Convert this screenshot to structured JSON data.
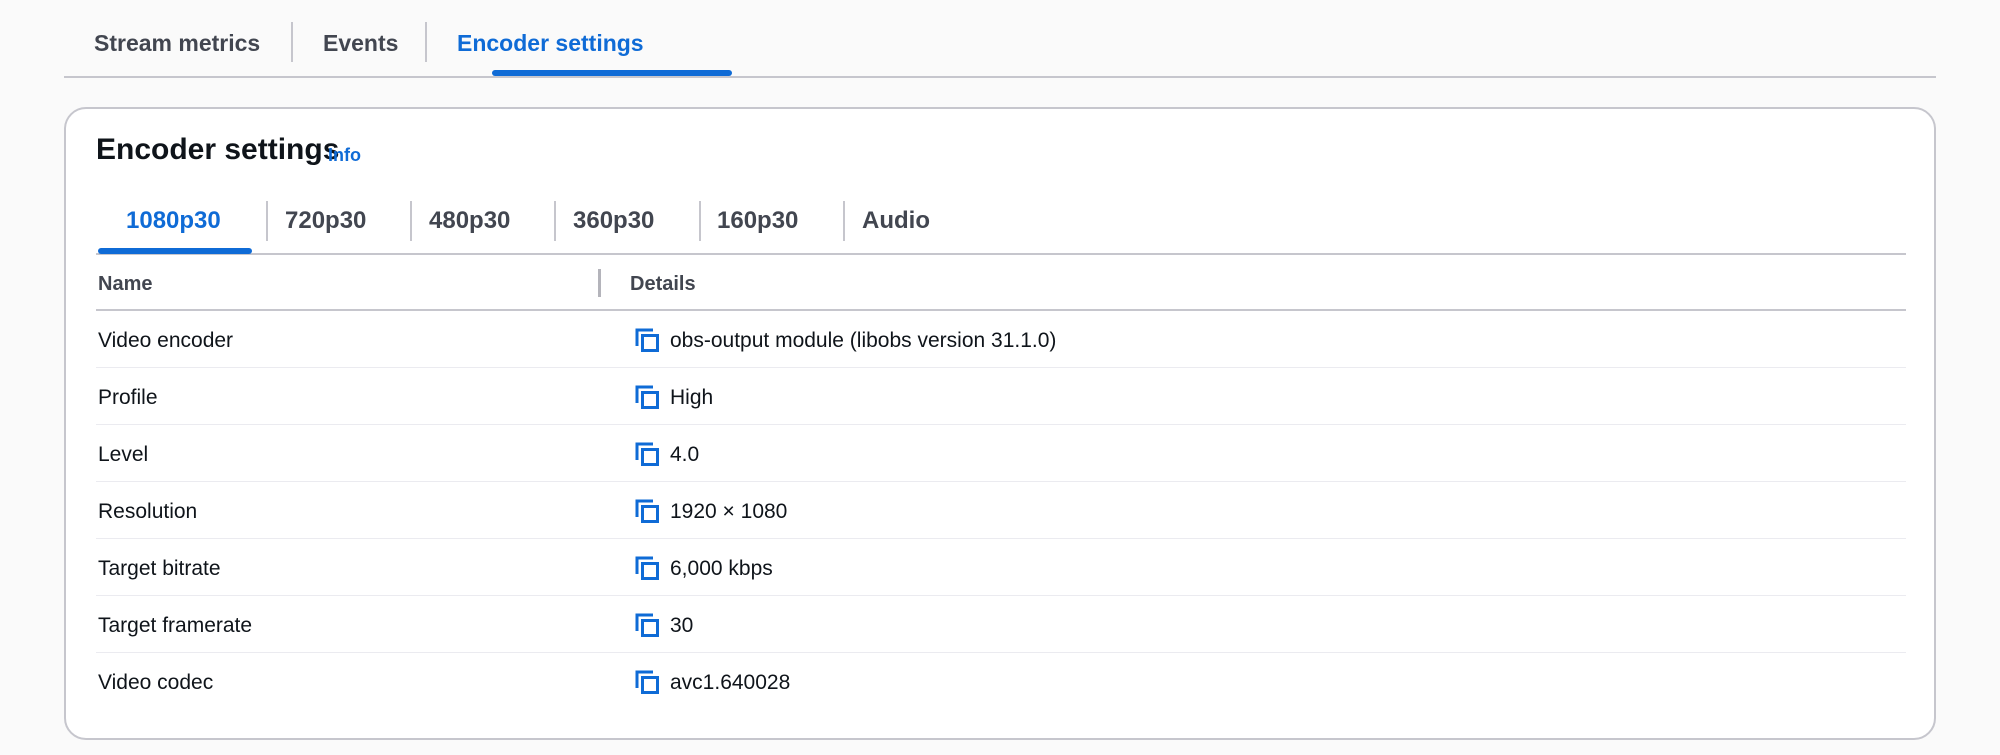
{
  "top_tabs": [
    "Stream metrics",
    "Events",
    "Encoder settings"
  ],
  "panel": {
    "title": "Encoder settings",
    "info_label": "Info"
  },
  "inner_tabs": [
    "1080p30",
    "720p30",
    "480p30",
    "360p30",
    "160p30",
    "Audio"
  ],
  "table": {
    "headers": {
      "name": "Name",
      "details": "Details"
    },
    "rows": [
      {
        "name": "Video encoder",
        "value": "obs-output module (libobs version 31.1.0)"
      },
      {
        "name": "Profile",
        "value": "High"
      },
      {
        "name": "Level",
        "value": "4.0"
      },
      {
        "name": "Resolution",
        "value": "1920 × 1080"
      },
      {
        "name": "Target bitrate",
        "value": "6,000 kbps"
      },
      {
        "name": "Target framerate",
        "value": "30"
      },
      {
        "name": "Video codec",
        "value": "avc1.640028"
      }
    ]
  },
  "colors": {
    "accent": "#0f6bd6",
    "border": "#c6c6cd",
    "text": "#0f141a",
    "muted": "#424650"
  },
  "icons": {
    "copy": "copy-icon"
  }
}
